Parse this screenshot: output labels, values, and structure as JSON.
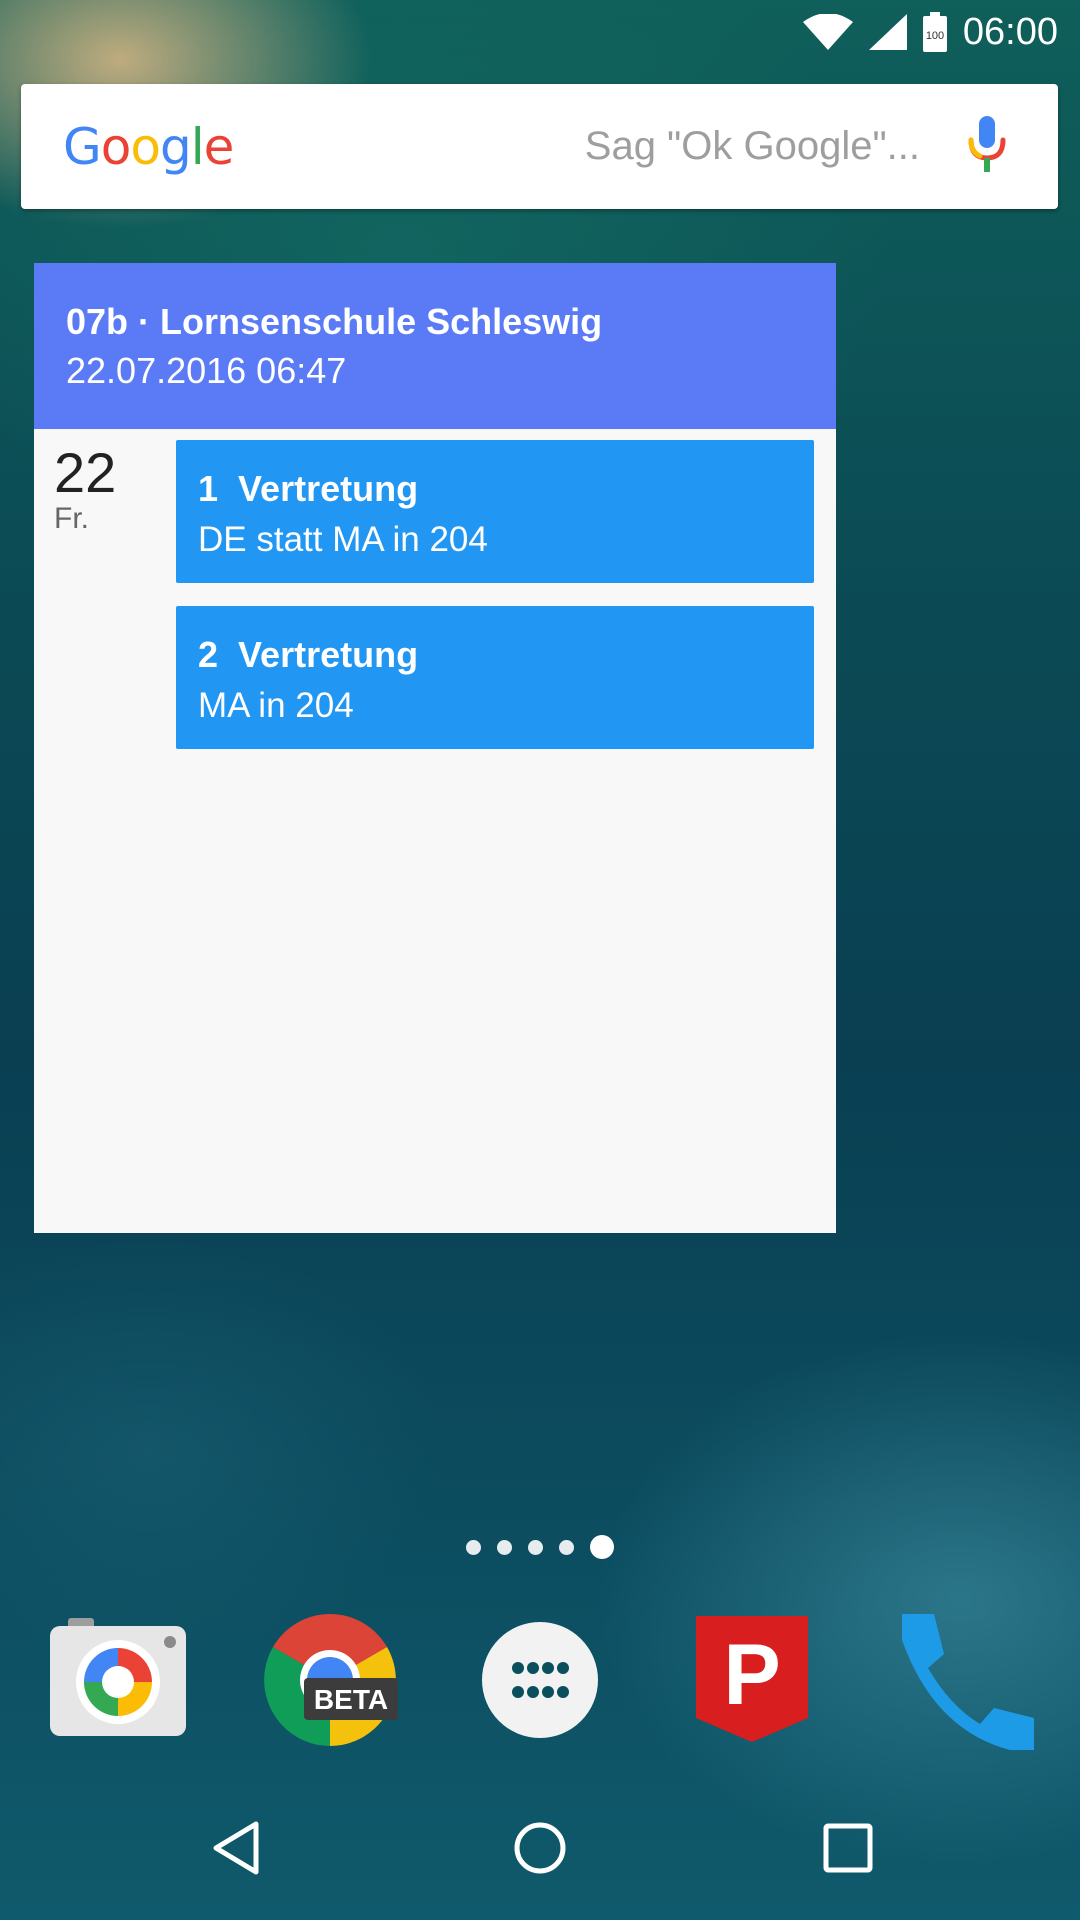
{
  "status_bar": {
    "time": "06:00",
    "battery_level": "100",
    "icons": [
      "wifi-icon",
      "cell-signal-icon",
      "battery-icon"
    ]
  },
  "search": {
    "logo_letters": [
      "G",
      "o",
      "o",
      "g",
      "l",
      "e"
    ],
    "logo_colors": [
      "#4285f4",
      "#ea4335",
      "#fbbc05",
      "#4285f4",
      "#34a853",
      "#ea4335"
    ],
    "hint": "Sag \"Ok Google\"...",
    "mic_icon": "mic-icon"
  },
  "widget": {
    "title": "07b · Lornsenschule Schleswig",
    "updated": "22.07.2016 06:47",
    "header_color": "#5b7bf6",
    "day": {
      "number": "22",
      "name": "Fr."
    },
    "entries": [
      {
        "lesson": "1",
        "type": "Vertretung",
        "text": "DE statt MA in 204"
      },
      {
        "lesson": "2",
        "type": "Vertretung",
        "text": "MA in 204"
      }
    ],
    "entry_color": "#2196f3"
  },
  "home": {
    "page_count": 5,
    "active_page": 5
  },
  "dock": {
    "apps": [
      {
        "name": "camera-app-icon"
      },
      {
        "name": "chrome-beta-app-icon",
        "badge": "BETA"
      },
      {
        "name": "all-apps-icon"
      },
      {
        "name": "p-app-icon",
        "letter": "P"
      },
      {
        "name": "phone-app-icon"
      }
    ]
  },
  "nav_bar": {
    "buttons": [
      "back-icon",
      "home-icon",
      "recents-icon"
    ]
  }
}
